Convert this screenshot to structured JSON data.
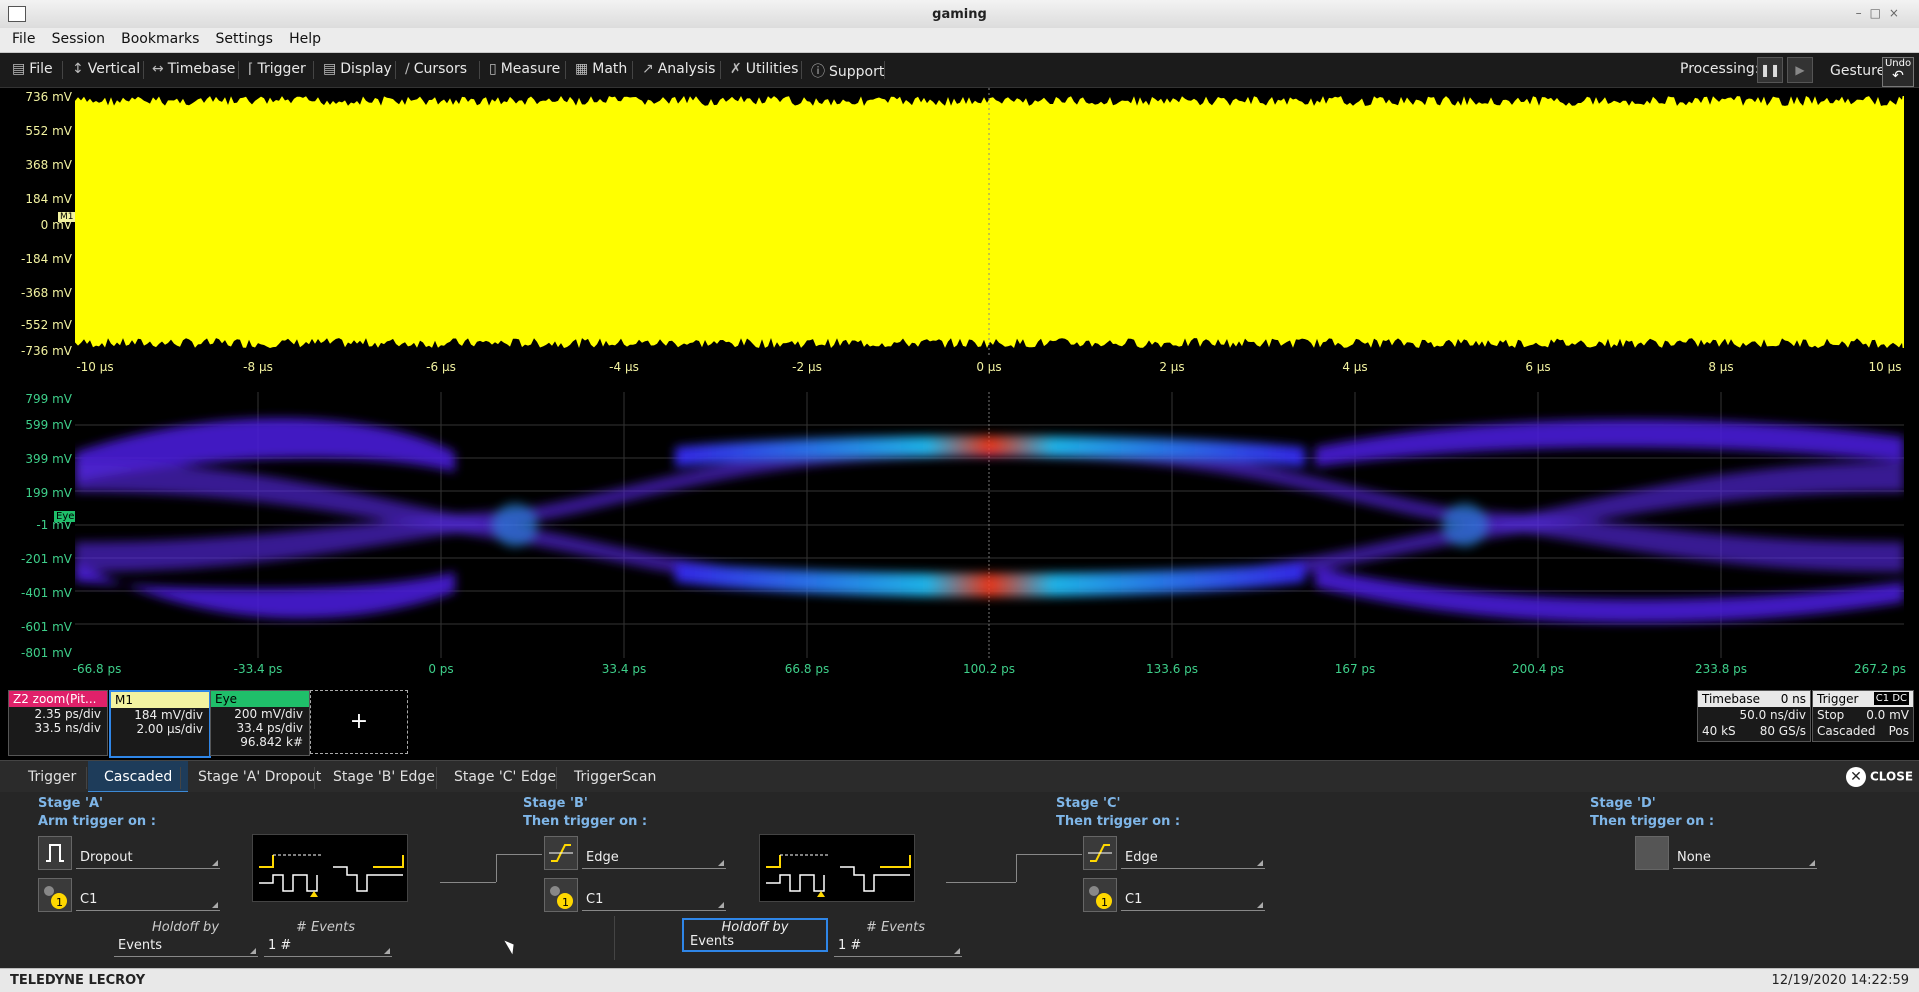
{
  "window": {
    "title": "gaming"
  },
  "menu": [
    "File",
    "Session",
    "Bookmarks",
    "Settings",
    "Help"
  ],
  "toolbar": {
    "items": [
      "File",
      "Vertical",
      "Timebase",
      "Trigger",
      "Display",
      "Cursors",
      "Measure",
      "Math",
      "Analysis",
      "Utilities",
      "Support"
    ],
    "processing_label": "Processing:",
    "gesture_label": "Gesture",
    "undo_label": "Undo"
  },
  "top_grid": {
    "y_labels": [
      "736 mV",
      "552 mV",
      "368 mV",
      "184 mV",
      "0 mV",
      "-184 mV",
      "-368 mV",
      "-552 mV",
      "-736 mV"
    ],
    "x_labels": [
      "-10 µs",
      "-8 µs",
      "-6 µs",
      "-4 µs",
      "-2 µs",
      "0 µs",
      "2 µs",
      "4 µs",
      "6 µs",
      "8 µs",
      "10 µs"
    ],
    "marker": "M1",
    "trace_color": "#ffff00"
  },
  "bottom_grid": {
    "y_labels": [
      "799 mV",
      "599 mV",
      "399 mV",
      "199 mV",
      "-1 mV",
      "-201 mV",
      "-401 mV",
      "-601 mV",
      "-801 mV"
    ],
    "x_labels": [
      "-66.8 ps",
      "-33.4 ps",
      "0 ps",
      "33.4 ps",
      "66.8 ps",
      "100.2 ps",
      "133.6 ps",
      "167 ps",
      "200.4 ps",
      "233.8 ps",
      "267.2 ps"
    ],
    "marker": "Eye"
  },
  "descriptors": {
    "z2": {
      "name": "Z2 zoom(Pit...",
      "l1": "2.35 ps/div",
      "l2": "33.5 ns/div",
      "color": "#e0216a"
    },
    "m1": {
      "name": "M1",
      "l1": "184 mV/div",
      "l2": "2.00 µs/div",
      "color": "#f2f2a0"
    },
    "eye": {
      "name": "Eye",
      "l1": "200 mV/div",
      "l2": "33.4 ps/div",
      "l3": "96.842 k#",
      "color": "#1fbf6a"
    },
    "add": "+"
  },
  "timebase": {
    "label": "Timebase",
    "delay": "0 ns",
    "tdiv": "50.0 ns/div",
    "samples": "40 kS",
    "rate": "80 GS/s"
  },
  "trigger_info": {
    "label": "Trigger",
    "ch": "C1",
    "coupling": "DC",
    "mode": "Stop",
    "level": "0.0 mV",
    "type": "Cascaded",
    "slope": "Pos"
  },
  "tabs": [
    "Trigger",
    "Cascaded",
    "Stage 'A' Dropout",
    "Stage 'B' Edge",
    "Stage 'C' Edge",
    "TriggerScan"
  ],
  "close_label": "CLOSE",
  "stages": {
    "a": {
      "title": "Stage 'A'",
      "sub": "Arm trigger on :",
      "type": "Dropout",
      "source": "C1"
    },
    "b": {
      "title": "Stage 'B'",
      "sub": "Then trigger on :",
      "type": "Edge",
      "source": "C1"
    },
    "c": {
      "title": "Stage 'C'",
      "sub": "Then trigger on :",
      "type": "Edge",
      "source": "C1"
    },
    "d": {
      "title": "Stage 'D'",
      "sub": "Then trigger on :",
      "type": "None"
    }
  },
  "holdoff": {
    "a": {
      "label": "Holdoff by",
      "value": "Events",
      "events_label": "# Events",
      "events_value": "1 #"
    },
    "b": {
      "label": "Holdoff by",
      "value": "Events",
      "events_label": "# Events",
      "events_value": "1 #"
    }
  },
  "status": {
    "brand": "TELEDYNE LECROY",
    "datetime": "12/19/2020 14:22:59"
  }
}
